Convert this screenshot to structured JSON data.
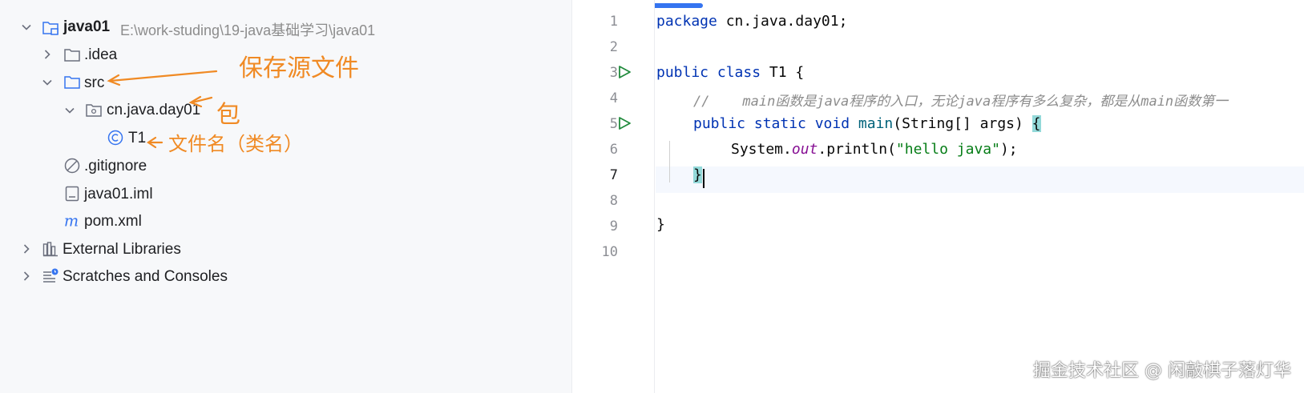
{
  "project_tree": {
    "root": {
      "name": "java01",
      "path": "E:\\work-studing\\19-java基础学习\\java01"
    },
    "items": [
      {
        "label": ".idea"
      },
      {
        "label": "src"
      },
      {
        "label": "cn.java.day01"
      },
      {
        "label": "T1"
      },
      {
        "label": ".gitignore"
      },
      {
        "label": "java01.iml"
      },
      {
        "label": "pom.xml"
      },
      {
        "label": "External Libraries"
      },
      {
        "label": "Scratches and Consoles"
      }
    ]
  },
  "annotations": {
    "src_note": "保存源文件",
    "package_note": "包",
    "file_note": "文件名（类名）"
  },
  "editor": {
    "line_numbers": [
      "1",
      "2",
      "3",
      "4",
      "5",
      "6",
      "7",
      "8",
      "9",
      "10"
    ],
    "code": {
      "l1_kw": "package",
      "l1_rest": " cn.java.day01;",
      "l3_kw": "public class",
      "l3_rest": " T1 {",
      "l4_comment": "//    main函数是java程序的入口，无论java程序有多么复杂，都是从main函数第一",
      "l5_kw": "public static void",
      "l5_fn": "main",
      "l5_rest": "(String[] args) ",
      "l5_brace": "{",
      "l6_obj": "System.",
      "l6_field": "out",
      "l6_method": ".println(",
      "l6_str": "\"hello java\"",
      "l6_end": ");",
      "l7_brace": "}",
      "l9_brace": "}"
    }
  },
  "watermark": "掘金技术社区 @ 闲敲棋子落灯华",
  "colors": {
    "keyword": "#0033b3",
    "string": "#067d17",
    "field": "#871094",
    "comment": "#8c8c8c",
    "annotation": "#f08a24",
    "tab_accent": "#3574f0"
  }
}
